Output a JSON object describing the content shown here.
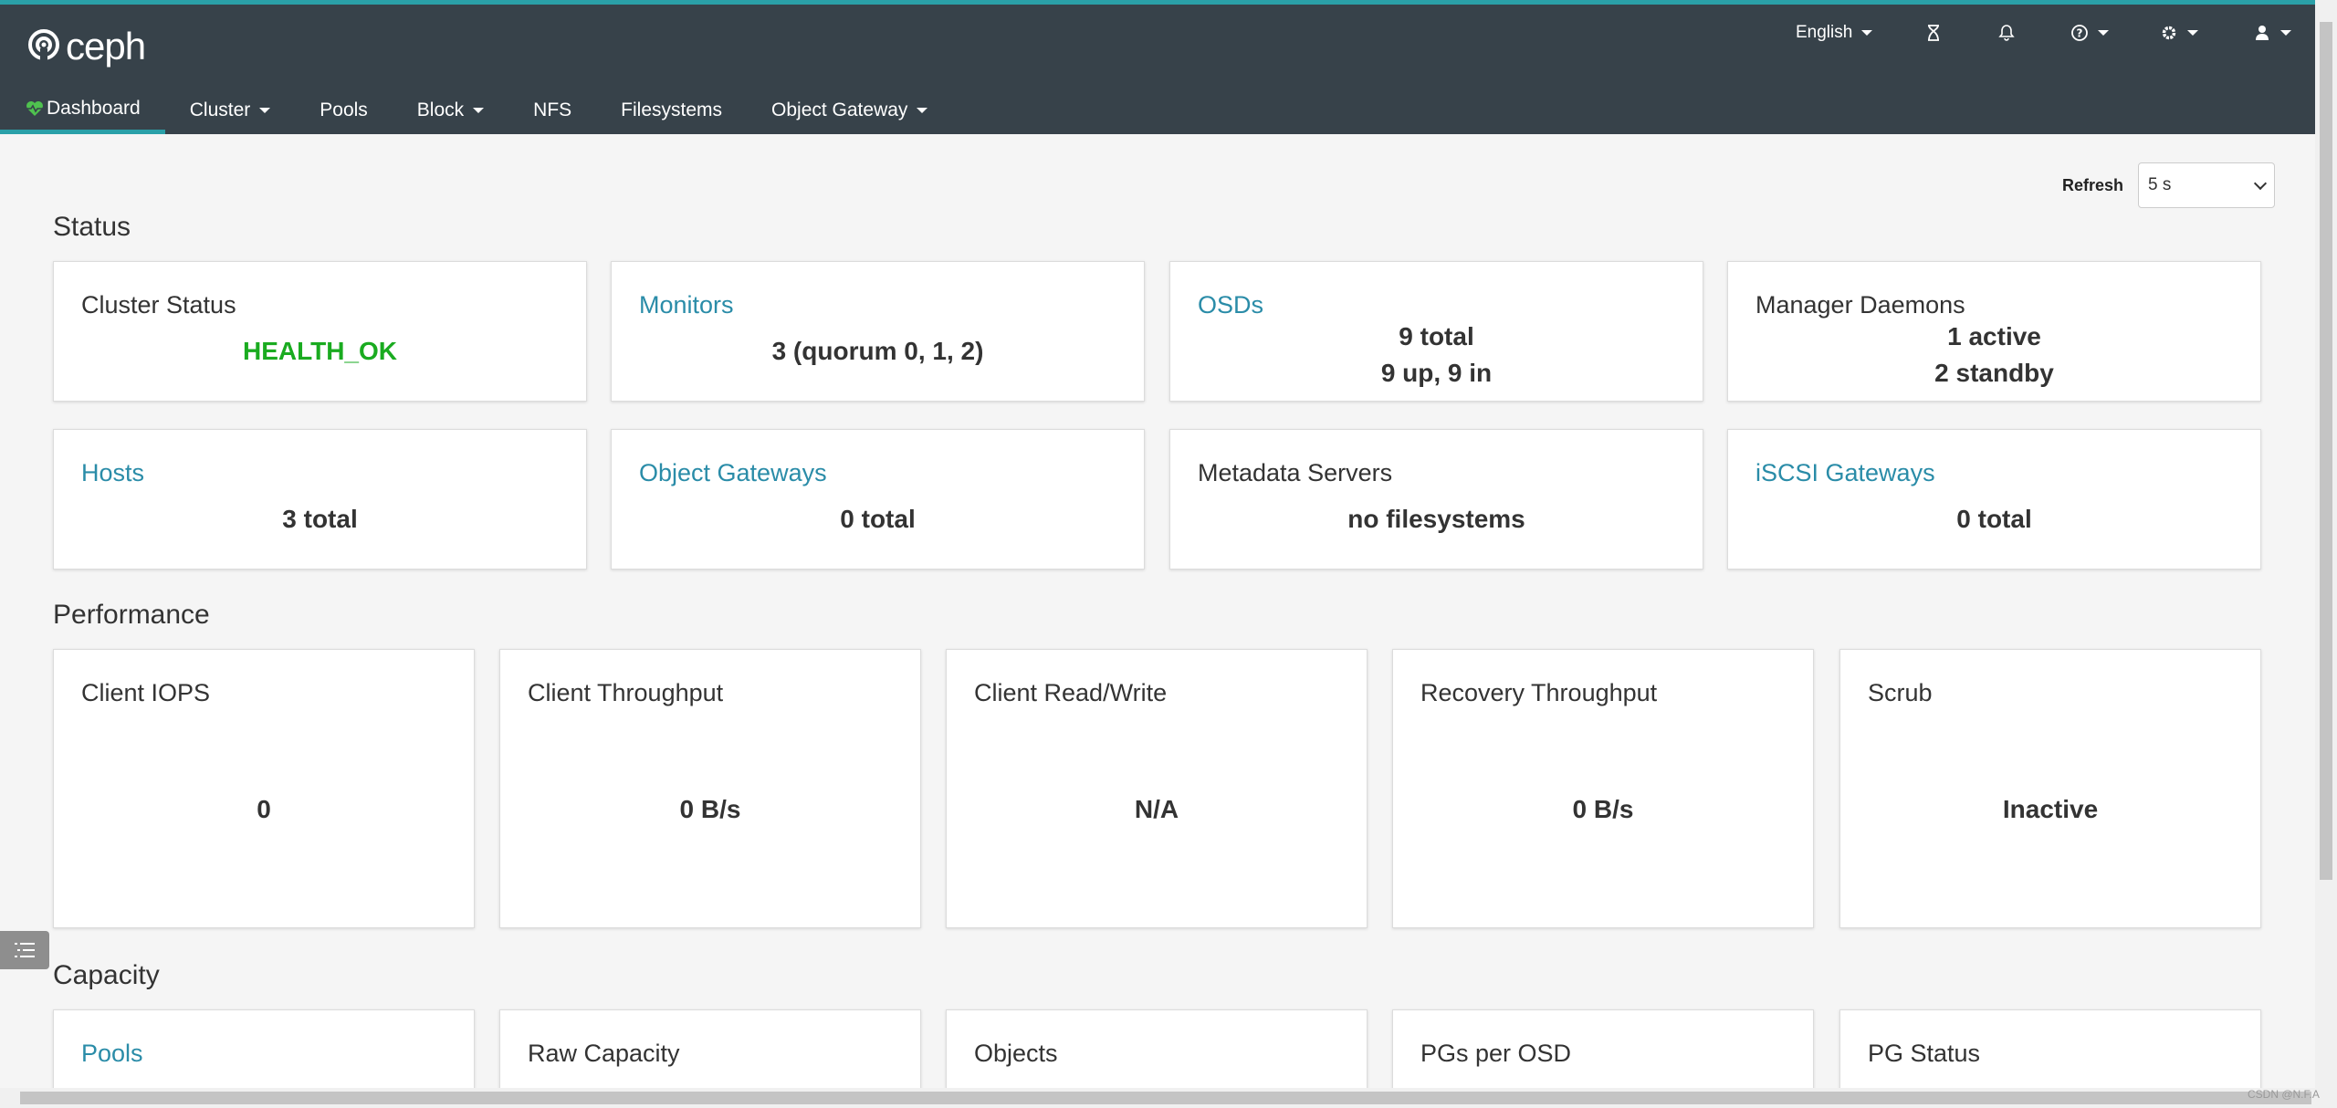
{
  "brand": {
    "name": "ceph"
  },
  "header": {
    "language": "English",
    "icons": [
      "hourglass-icon",
      "bell-icon",
      "help-icon",
      "gear-icon",
      "user-icon"
    ]
  },
  "nav": [
    {
      "label": "Dashboard",
      "active": true,
      "dropdown": false
    },
    {
      "label": "Cluster",
      "dropdown": true
    },
    {
      "label": "Pools",
      "dropdown": false
    },
    {
      "label": "Block",
      "dropdown": true
    },
    {
      "label": "NFS",
      "dropdown": false
    },
    {
      "label": "Filesystems",
      "dropdown": false
    },
    {
      "label": "Object Gateway",
      "dropdown": true
    }
  ],
  "refresh": {
    "label": "Refresh",
    "value": "5 s"
  },
  "sections": {
    "status": "Status",
    "performance": "Performance",
    "capacity": "Capacity"
  },
  "status_cards": [
    {
      "title": "Cluster Status",
      "link": false,
      "lines": [
        "HEALTH_OK"
      ]
    },
    {
      "title": "Monitors",
      "link": true,
      "lines": [
        "3 (quorum 0, 1, 2)"
      ]
    },
    {
      "title": "OSDs",
      "link": true,
      "lines": [
        "9 total",
        "9 up, 9 in"
      ]
    },
    {
      "title": "Manager Daemons",
      "link": false,
      "lines": [
        "1 active",
        "2 standby"
      ]
    },
    {
      "title": "Hosts",
      "link": true,
      "lines": [
        "3 total"
      ]
    },
    {
      "title": "Object Gateways",
      "link": true,
      "lines": [
        "0 total"
      ]
    },
    {
      "title": "Metadata Servers",
      "link": false,
      "lines": [
        "no filesystems"
      ]
    },
    {
      "title": "iSCSI Gateways",
      "link": true,
      "lines": [
        "0 total"
      ]
    }
  ],
  "performance_cards": [
    {
      "title": "Client IOPS",
      "value": "0"
    },
    {
      "title": "Client Throughput",
      "value": "0 B/s"
    },
    {
      "title": "Client Read/Write",
      "value": "N/A"
    },
    {
      "title": "Recovery Throughput",
      "value": "0 B/s"
    },
    {
      "title": "Scrub",
      "value": "Inactive"
    }
  ],
  "capacity_cards": [
    {
      "title": "Pools",
      "link": true
    },
    {
      "title": "Raw Capacity",
      "link": false
    },
    {
      "title": "Objects",
      "link": false
    },
    {
      "title": "PGs per OSD",
      "link": false
    },
    {
      "title": "PG Status",
      "link": false
    }
  ],
  "colors": {
    "header_bg": "#37424a",
    "accent": "#2aa0a8",
    "link": "#2a8ca8",
    "health_ok": "#1aab20"
  },
  "watermark": "CSDN @N.F.A"
}
